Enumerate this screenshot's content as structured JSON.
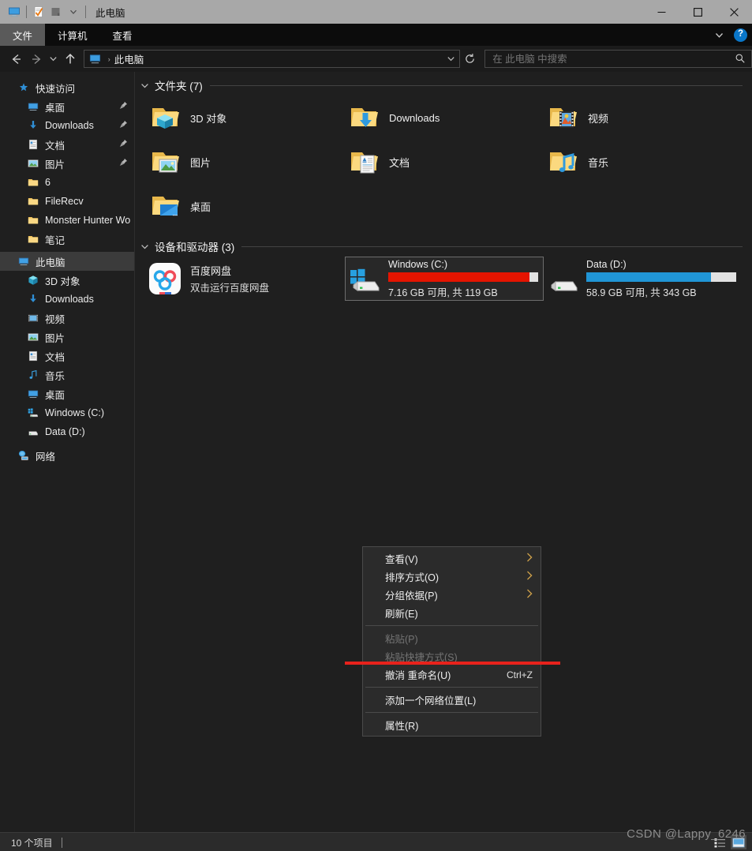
{
  "window": {
    "title": "此电脑",
    "quick_access_toolbar": [
      {
        "name": "this-pc-icon",
        "icon": "monitor-icon"
      },
      {
        "name": "properties-icon",
        "icon": "document-check-icon"
      },
      {
        "name": "new-folder-icon",
        "icon": "folder-icon"
      },
      {
        "name": "customize-dropdown",
        "icon": "chevron-down-icon"
      }
    ],
    "controls": {
      "minimize": "–",
      "maximize": "□",
      "close": "✕"
    }
  },
  "ribbon": {
    "tabs": [
      {
        "label": "文件",
        "active": true
      },
      {
        "label": "计算机",
        "active": false
      },
      {
        "label": "查看",
        "active": false
      }
    ],
    "collapse_icon": "chevron-down-icon",
    "help_label": "?"
  },
  "navbar": {
    "back_icon": "arrow-left-icon",
    "forward_icon": "arrow-right-icon",
    "recent_icon": "chevron-down-icon",
    "up_icon": "arrow-up-icon",
    "breadcrumb": {
      "icon": "monitor-icon",
      "separator": "›",
      "text": "此电脑"
    },
    "address_dropdown_icon": "chevron-down-icon",
    "refresh_icon": "refresh-icon",
    "search": {
      "placeholder": "在 此电脑 中搜索",
      "value": "",
      "icon": "search-icon"
    }
  },
  "sidebar": {
    "items": [
      {
        "label": "快速访问",
        "icon": "star-pin-icon",
        "depth": 0,
        "pinned": false,
        "selected": false
      },
      {
        "label": "桌面",
        "icon": "desktop-icon",
        "depth": 1,
        "pinned": true,
        "selected": false
      },
      {
        "label": "Downloads",
        "icon": "download-icon",
        "depth": 1,
        "pinned": true,
        "selected": false
      },
      {
        "label": "文档",
        "icon": "documents-icon",
        "depth": 1,
        "pinned": true,
        "selected": false
      },
      {
        "label": "图片",
        "icon": "pictures-icon",
        "depth": 1,
        "pinned": true,
        "selected": false
      },
      {
        "label": "6",
        "icon": "folder-icon",
        "depth": 1,
        "pinned": false,
        "selected": false
      },
      {
        "label": "FileRecv",
        "icon": "folder-icon",
        "depth": 1,
        "pinned": false,
        "selected": false
      },
      {
        "label": "Monster Hunter Wo",
        "icon": "folder-icon",
        "depth": 1,
        "pinned": false,
        "selected": false
      },
      {
        "label": "笔记",
        "icon": "folder-icon",
        "depth": 1,
        "pinned": false,
        "selected": false
      },
      {
        "label": "此电脑",
        "icon": "monitor-icon",
        "depth": 0,
        "pinned": false,
        "selected": true
      },
      {
        "label": "3D 对象",
        "icon": "3d-object-icon",
        "depth": 1,
        "pinned": false,
        "selected": false
      },
      {
        "label": "Downloads",
        "icon": "download-icon",
        "depth": 1,
        "pinned": false,
        "selected": false
      },
      {
        "label": "视频",
        "icon": "videos-icon",
        "depth": 1,
        "pinned": false,
        "selected": false
      },
      {
        "label": "图片",
        "icon": "pictures-icon",
        "depth": 1,
        "pinned": false,
        "selected": false
      },
      {
        "label": "文档",
        "icon": "documents-icon",
        "depth": 1,
        "pinned": false,
        "selected": false
      },
      {
        "label": "音乐",
        "icon": "music-icon",
        "depth": 1,
        "pinned": false,
        "selected": false
      },
      {
        "label": "桌面",
        "icon": "desktop-icon",
        "depth": 1,
        "pinned": false,
        "selected": false
      },
      {
        "label": "Windows (C:)",
        "icon": "windows-drive-icon",
        "depth": 1,
        "pinned": false,
        "selected": false
      },
      {
        "label": "Data (D:)",
        "icon": "drive-icon",
        "depth": 1,
        "pinned": false,
        "selected": false
      },
      {
        "label": "网络",
        "icon": "network-icon",
        "depth": 0,
        "pinned": false,
        "selected": false
      }
    ]
  },
  "main": {
    "folders_group": {
      "title": "文件夹 (7)",
      "chevron": "chevron-down-icon",
      "items": [
        {
          "label": "3D 对象",
          "icon": "folder-3d-icon"
        },
        {
          "label": "Downloads",
          "icon": "folder-downloads-icon"
        },
        {
          "label": "视频",
          "icon": "folder-videos-icon"
        },
        {
          "label": "图片",
          "icon": "folder-pictures-icon"
        },
        {
          "label": "文档",
          "icon": "folder-documents-icon"
        },
        {
          "label": "音乐",
          "icon": "folder-music-icon"
        },
        {
          "label": "桌面",
          "icon": "folder-desktop-icon"
        }
      ]
    },
    "devices_group": {
      "title": "设备和驱动器 (3)",
      "chevron": "chevron-down-icon",
      "app": {
        "label": "百度网盘",
        "sublabel": "双击运行百度网盘",
        "icon": "baidu-netdisk-icon"
      },
      "drives": [
        {
          "name": "Windows (C:)",
          "free_text": "7.16 GB 可用, 共 119 GB",
          "used_percent": 94,
          "bar_color": "#e51400",
          "icon": "windows-drive-icon",
          "selected": true
        },
        {
          "name": "Data (D:)",
          "free_text": "58.9 GB 可用, 共 343 GB",
          "used_percent": 83,
          "bar_color": "#2095d6",
          "icon": "drive-icon",
          "selected": false
        }
      ]
    }
  },
  "context_menu": {
    "items": [
      {
        "label": "查看(V)",
        "submenu": true,
        "disabled": false,
        "accel": ""
      },
      {
        "label": "排序方式(O)",
        "submenu": true,
        "disabled": false,
        "accel": ""
      },
      {
        "label": "分组依据(P)",
        "submenu": true,
        "disabled": false,
        "accel": ""
      },
      {
        "label": "刷新(E)",
        "submenu": false,
        "disabled": false,
        "accel": ""
      },
      {
        "divider": true
      },
      {
        "label": "粘贴(P)",
        "submenu": false,
        "disabled": true,
        "accel": ""
      },
      {
        "label": "粘贴快捷方式(S)",
        "submenu": false,
        "disabled": true,
        "accel": ""
      },
      {
        "label": "撤消 重命名(U)",
        "submenu": false,
        "disabled": false,
        "accel": "Ctrl+Z"
      },
      {
        "divider": true
      },
      {
        "label": "添加一个网络位置(L)",
        "submenu": false,
        "disabled": false,
        "accel": ""
      },
      {
        "divider": true
      },
      {
        "label": "属性(R)",
        "submenu": false,
        "disabled": false,
        "accel": ""
      }
    ],
    "submenu_arrow": "chevron-right-icon"
  },
  "statusbar": {
    "item_count": "10 个项目",
    "view_buttons": [
      {
        "name": "details-view-button",
        "icon": "list-details-icon",
        "active": false
      },
      {
        "name": "large-icons-view-button",
        "icon": "large-icons-icon",
        "active": true
      }
    ]
  },
  "watermark": "CSDN @Lappy_6246",
  "colors": {
    "window_bg": "#1f1f1f",
    "titlebar_bg": "#a8a8a8",
    "ribbon_bg": "#0c0c0c",
    "accent_blue": "#2095d6",
    "drive_red": "#e51400",
    "annotation_red": "#e8221c",
    "folder_yellow": "#f5c96b"
  }
}
